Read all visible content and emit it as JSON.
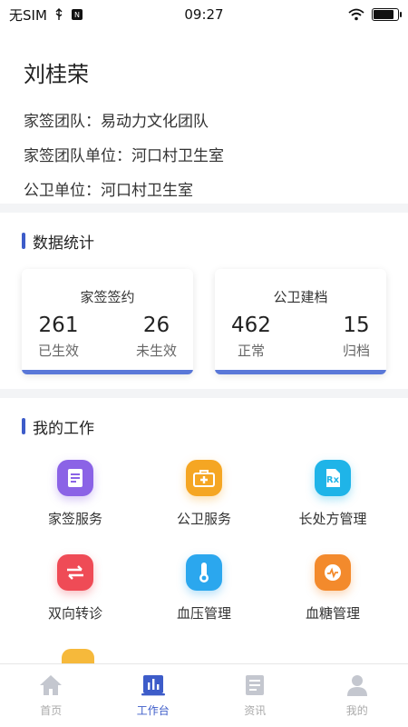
{
  "status_bar": {
    "carrier": "无SIM",
    "time": "09:27"
  },
  "profile": {
    "name": "刘桂荣",
    "team": "家签团队：易动力文化团队",
    "team_unit": "家签团队单位：河口村卫生室",
    "health_unit": "公卫单位：河口村卫生室"
  },
  "stats": {
    "title": "数据统计",
    "cards": [
      {
        "title": "家签签约",
        "a_value": "261",
        "a_label": "已生效",
        "b_value": "26",
        "b_label": "未生效"
      },
      {
        "title": "公卫建档",
        "a_value": "462",
        "a_label": "正常",
        "b_value": "15",
        "b_label": "归档"
      }
    ]
  },
  "work": {
    "title": "我的工作",
    "items": [
      {
        "label": "家签服务",
        "icon": "document-icon",
        "color": "#8b63e6"
      },
      {
        "label": "公卫服务",
        "icon": "medical-box-icon",
        "color": "#f5a623"
      },
      {
        "label": "长处方管理",
        "icon": "prescription-icon",
        "color": "#1fb4e8"
      },
      {
        "label": "双向转诊",
        "icon": "transfer-arrows-icon",
        "color": "#ef4b56"
      },
      {
        "label": "血压管理",
        "icon": "thermometer-icon",
        "color": "#2ba7ee"
      },
      {
        "label": "血糖管理",
        "icon": "glucose-icon",
        "color": "#f38a2c"
      }
    ]
  },
  "tabbar": {
    "items": [
      {
        "label": "首页",
        "icon": "home-icon"
      },
      {
        "label": "工作台",
        "icon": "workbench-icon"
      },
      {
        "label": "资讯",
        "icon": "news-icon"
      },
      {
        "label": "我的",
        "icon": "user-icon"
      }
    ],
    "active": "工作台",
    "active_color": "#3d5cc9"
  }
}
